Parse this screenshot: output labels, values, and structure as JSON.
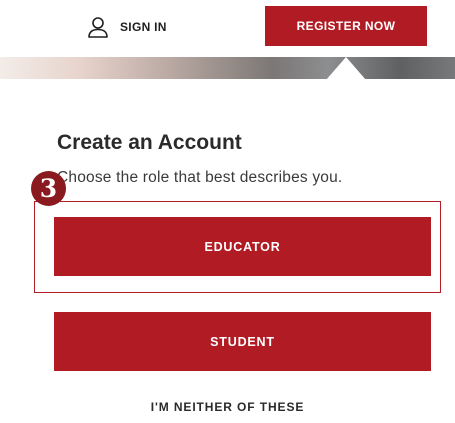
{
  "header": {
    "signin_label": "SIGN IN",
    "register_label": "REGISTER NOW",
    "user_icon": "user-icon"
  },
  "account": {
    "title": "Create an Account",
    "subtitle": "Choose the role that best describes you."
  },
  "step_badge": "3",
  "roles": {
    "educator": "EDUCATOR",
    "student": "STUDENT",
    "neither": "I'M NEITHER OF THESE"
  },
  "colors": {
    "brand_red": "#b11c24",
    "badge_red": "#8a1a1f",
    "text": "#2b2b2b"
  }
}
